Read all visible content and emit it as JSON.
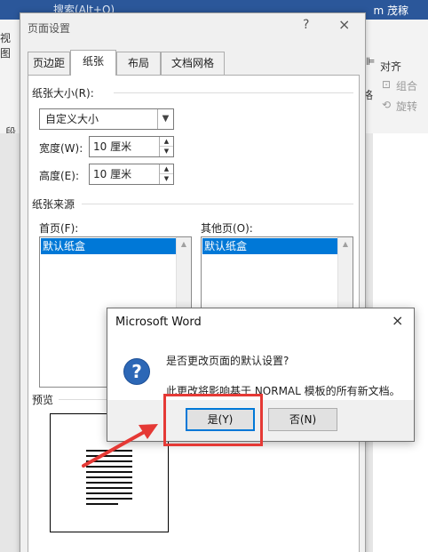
{
  "word": {
    "search": "搜索(Alt+Q)",
    "user": "m 茂稼",
    "ribbon_left": [
      "视图",
      "段"
    ],
    "ribbon_right": {
      "align": "对齐",
      "group": "组合",
      "rotate": "旋转",
      "wrap": "格"
    }
  },
  "page_setup": {
    "title": "页面设置",
    "help": "?",
    "close": "×",
    "tabs": [
      {
        "label": "页边距"
      },
      {
        "label": "纸张"
      },
      {
        "label": "布局"
      },
      {
        "label": "文档网格"
      }
    ],
    "paper_size": {
      "group_label": "纸张大小(R):",
      "selected": "自定义大小",
      "width_label": "宽度(W):",
      "width_value": "10 厘米",
      "height_label": "高度(E):",
      "height_value": "10 厘米"
    },
    "paper_source": {
      "group_label": "纸张来源",
      "first_page_label": "首页(F):",
      "first_page_selected": "默认纸盒",
      "other_pages_label": "其他页(O):",
      "other_pages_selected": "默认纸盒"
    },
    "preview_label": "预览"
  },
  "message_box": {
    "title": "Microsoft Word",
    "close": "×",
    "icon": "?",
    "line1": "是否更改页面的默认设置?",
    "line2": "此更改将影响基于 NORMAL 模板的所有新文档。",
    "yes": "是(Y)",
    "no": "否(N)"
  },
  "colors": {
    "accent": "#0078d7",
    "highlight": "#e53935",
    "word_blue": "#2b579a"
  }
}
